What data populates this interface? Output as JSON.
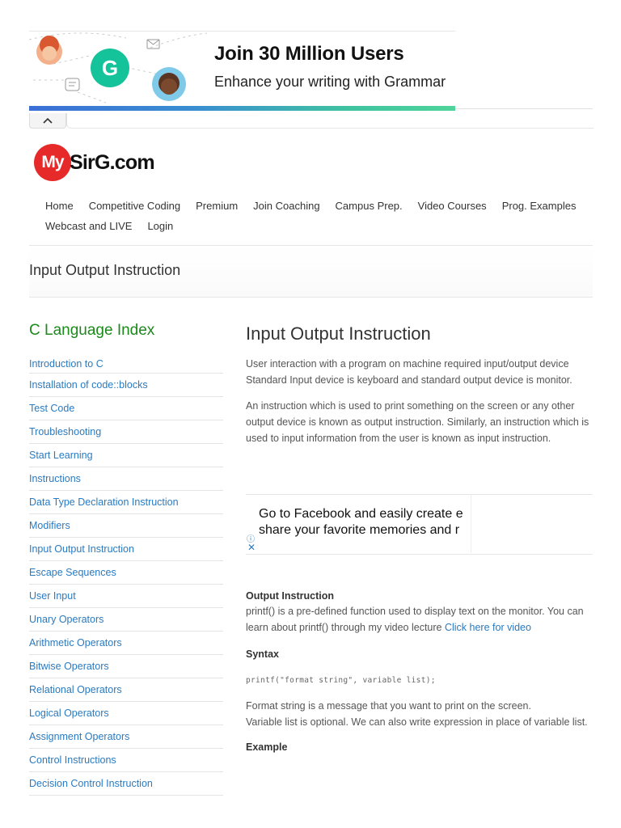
{
  "ad_banner": {
    "title": "Join 30 Million Users",
    "subtitle": "Enhance your writing with Grammar",
    "logo_letter": "G",
    "brand_color": "#15c39a"
  },
  "site": {
    "logo_my": "My",
    "logo_text": "SirG.com",
    "logo_color": "#e62a2a"
  },
  "nav": {
    "row1": [
      "Home",
      "Competitive Coding",
      "Premium",
      "Join Coaching",
      "Campus Prep.",
      "Video Courses",
      "Prog. Examples"
    ],
    "row2": [
      "Webcast and LIVE",
      "Login"
    ]
  },
  "page_title": "Input Output Instruction",
  "sidebar": {
    "title": "C Language Index",
    "items": [
      "Introduction to C",
      "Installation of code::blocks",
      "Test Code",
      "Troubleshooting",
      "Start Learning",
      "Instructions",
      "Data Type Declaration Instruction",
      "Modifiers",
      "Input Output Instruction",
      "Escape Sequences",
      "User Input",
      "Unary Operators",
      "Arithmetic Operators",
      "Bitwise Operators",
      "Relational Operators",
      "Logical Operators",
      "Assignment Operators",
      "Control Instructions",
      "Decision Control Instruction"
    ]
  },
  "main": {
    "heading": "Input Output Instruction",
    "para1": "User interaction with a program on machine required input/output device Standard Input device is keyboard and standard output device is monitor.",
    "para2": "An instruction which is used to print something on the screen or any other output device is known as output instruction. Similarly, an instruction which is used to input information from the user is known as input instruction.",
    "ad2_line1": "Go to Facebook and easily create e",
    "ad2_line2": "share your favorite memories and r",
    "output_head": "Output Instruction",
    "output_text": "printf() is a pre-defined function used to display text on the monitor. You can learn about printf() through my video lecture ",
    "video_link": "Click here for video",
    "syntax_head": "Syntax",
    "syntax_code": "printf(\"format string\", variable list);",
    "format_line1": "Format string is a message that you want to print on the screen.",
    "format_line2": "Variable list is optional. We can also write expression in place of variable list.",
    "example_head": "Example"
  }
}
